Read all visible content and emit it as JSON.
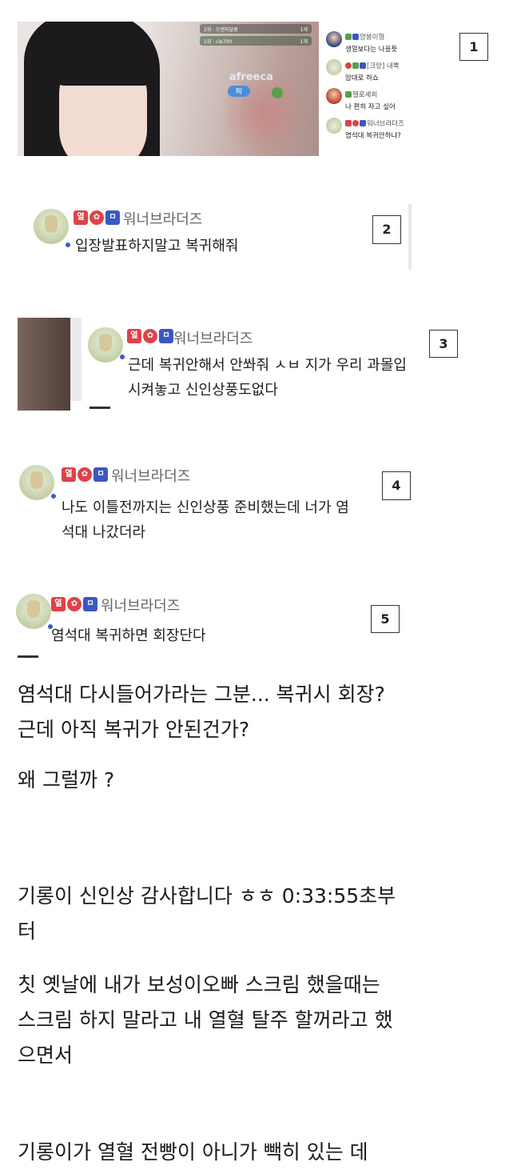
{
  "video": {
    "rank_1_label": "2위 · 오캔지달콤",
    "rank_1_count": "1개",
    "rank_2_label": "1위 · cle700",
    "rank_2_count": "1개",
    "watermark": "afreeca",
    "bj_mark": "BJ"
  },
  "chat1": {
    "number": "1",
    "messages": [
      {
        "name": "양봉이형",
        "text": "생얼보다는 나을듯"
      },
      {
        "name": "[크앙] 내뽁",
        "text": "맘대로 하쇼"
      },
      {
        "name": "헬로세희",
        "text": "나 편히 자고 싶어"
      },
      {
        "name": "워너브라더즈",
        "text": "염석대 복귀안하냐?"
      }
    ]
  },
  "chat2": {
    "number": "2",
    "name": "워너브라더즈",
    "text": "입장발표하지말고 복귀해줘"
  },
  "chat3": {
    "number": "3",
    "name": "워너브라더즈",
    "text_line1": "근데 복귀안해서 안쏴줘 ㅅㅂ 지가 우리 과몰입",
    "text_line2": "시켜놓고 신인상풍도없다"
  },
  "chat4": {
    "number": "4",
    "name": "워너브라더즈",
    "text_line1": "나도 이틀전까지는 신인상풍 준비했는데 너가 염",
    "text_line2": "석대 나갔더라"
  },
  "chat5": {
    "number": "5",
    "name": "워너브라더즈",
    "text": "염석대 복귀하면 회장단다"
  },
  "article": {
    "p1_line1": "염석대 다시들어가라는 그분... 복귀시 회장?",
    "p1_line2": "근데 아직 복귀가 안된건가?",
    "p2": "왜 그럴까 ?",
    "p3_line1": "기롱이 신인상 감사합니다 ㅎㅎ 0:33:55초부",
    "p3_line2": "터",
    "p4_line1": "칫 옛날에 내가 보성이오빠 스크림 했을때는",
    "p4_line2": "스크림 하지 말라고 내 열혈 탈주 할꺼라고 했",
    "p4_line3": "으면서",
    "p5_partial": "기롱이가 열혈 전빵이 아니가 빽히 있는 데"
  },
  "colors": {
    "badge_red": "#e0414a",
    "badge_blue": "#3b57c6",
    "badge_green": "#58a04c"
  }
}
